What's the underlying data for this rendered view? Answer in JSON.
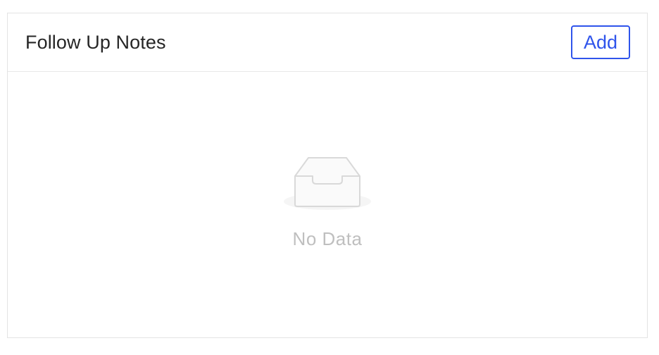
{
  "card": {
    "title": "Follow Up Notes",
    "add_label": "Add"
  },
  "empty_state": {
    "icon": "empty-inbox-icon",
    "text": "No Data"
  },
  "colors": {
    "accent": "#2f54eb",
    "title_text": "#262626",
    "muted_text": "#bfbfbf",
    "border": "#e3e3e3"
  }
}
